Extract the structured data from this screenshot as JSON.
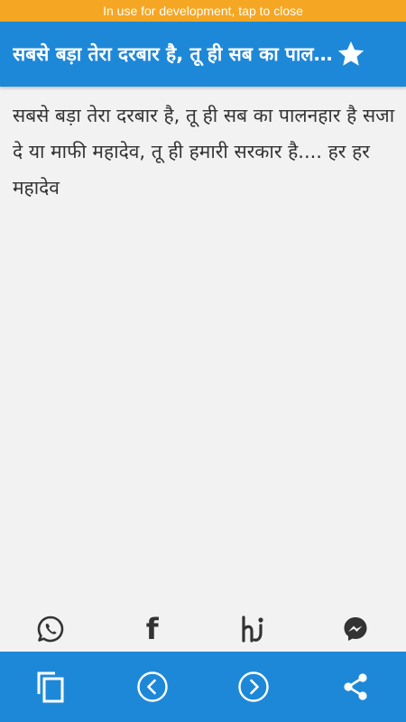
{
  "status_bar": {
    "text": "In use for development, tap to close"
  },
  "app_bar": {
    "title": "सबसे बड़ा तेरा दरबार है, तू ही सब का पालनहार",
    "favorite_icon": "star-icon"
  },
  "content": {
    "text": "सबसे बड़ा तेरा दरबार है, तू ही सब का पालनहार है सजा दे या माफी महादेव, तू ही हमारी सरकार है.... हर हर महादेव"
  },
  "share_row": {
    "items": [
      {
        "icon": "whatsapp-icon"
      },
      {
        "icon": "facebook-icon",
        "glyph": "f"
      },
      {
        "icon": "hike-icon"
      },
      {
        "icon": "messenger-icon"
      }
    ]
  },
  "bottom_bar": {
    "items": [
      {
        "icon": "copy-icon"
      },
      {
        "icon": "previous-icon"
      },
      {
        "icon": "next-icon"
      },
      {
        "icon": "share-icon"
      }
    ]
  },
  "colors": {
    "primary": "#1e88d8",
    "status": "#f5a623",
    "background": "#f2f2f2",
    "text": "#333333"
  }
}
